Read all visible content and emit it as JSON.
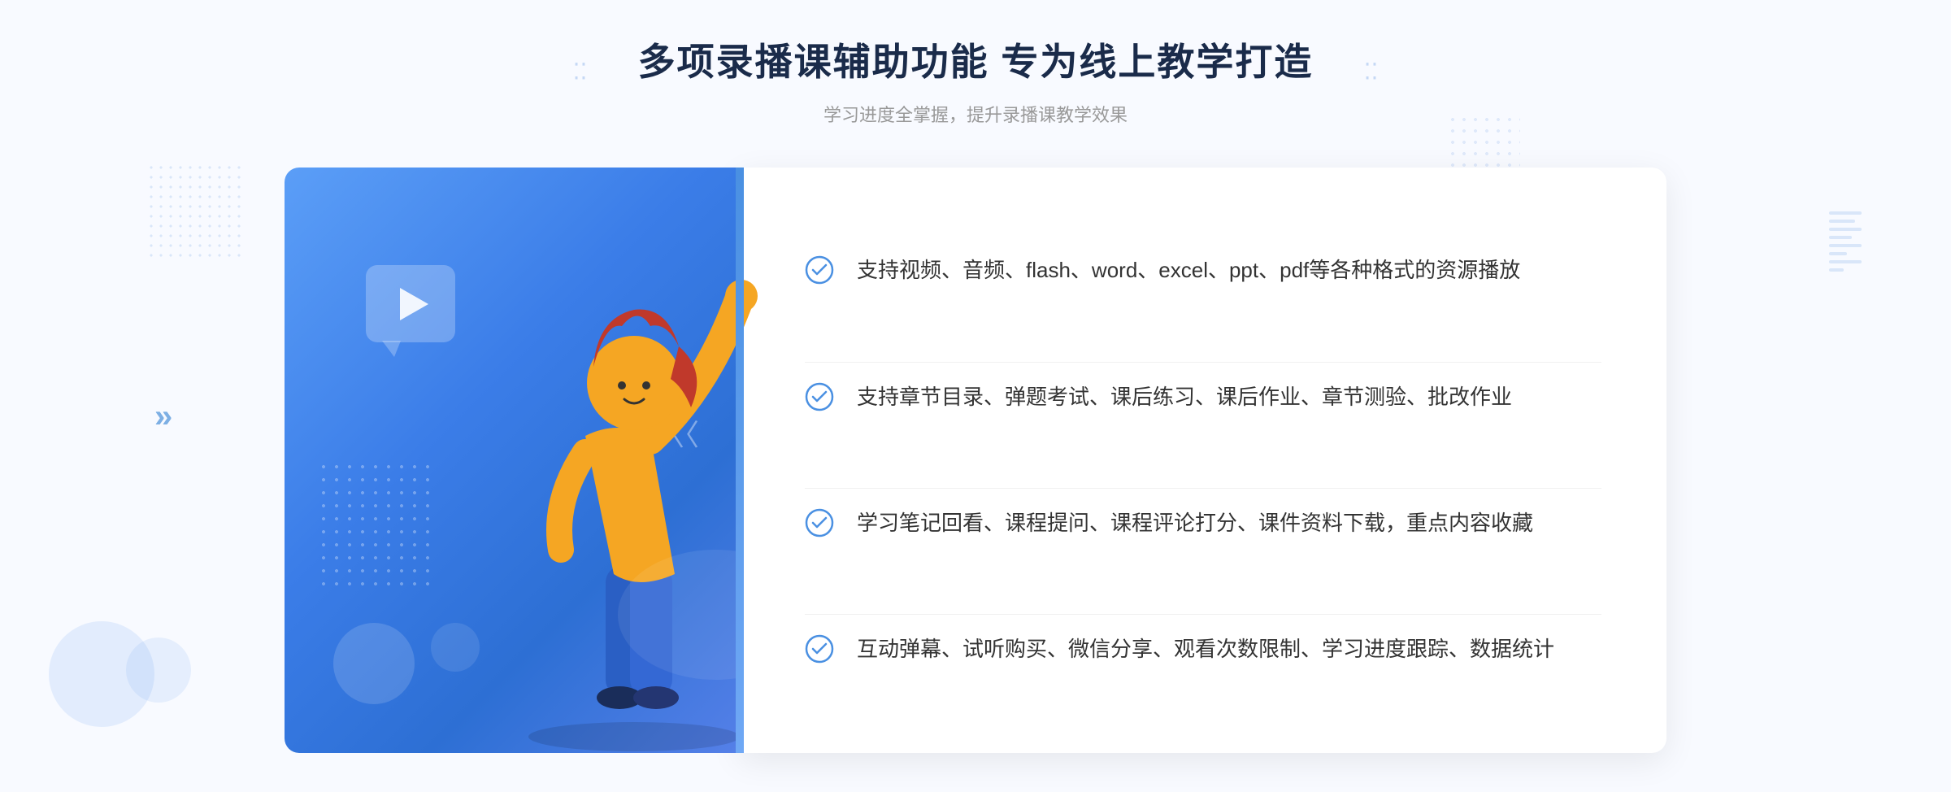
{
  "page": {
    "background_color": "#f8faff"
  },
  "header": {
    "main_title": "多项录播课辅助功能 专为线上教学打造",
    "sub_title": "学习进度全掌握，提升录播课教学效果",
    "decoration_left": "⁚⁚",
    "decoration_right": "⁚⁚"
  },
  "features": [
    {
      "id": 1,
      "text": "支持视频、音频、flash、word、excel、ppt、pdf等各种格式的资源播放"
    },
    {
      "id": 2,
      "text": "支持章节目录、弹题考试、课后练习、课后作业、章节测验、批改作业"
    },
    {
      "id": 3,
      "text": "学习笔记回看、课程提问、课程评论打分、课件资料下载，重点内容收藏"
    },
    {
      "id": 4,
      "text": "互动弹幕、试听购买、微信分享、观看次数限制、学习进度跟踪、数据统计"
    }
  ],
  "icons": {
    "check_circle": "check-circle",
    "play": "play-icon",
    "chevron": "chevron-icon"
  },
  "colors": {
    "primary_blue": "#4a90e2",
    "gradient_start": "#5b9ef7",
    "gradient_end": "#3b7de8",
    "text_dark": "#1a2b4a",
    "text_gray": "#999999",
    "text_body": "#333333",
    "accent": "#c5d8f5"
  }
}
